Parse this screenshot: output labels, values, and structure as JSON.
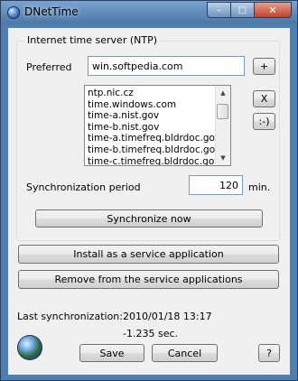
{
  "window": {
    "title": "DNetTime",
    "caption": {
      "minimize": "–",
      "maximize": "□",
      "close": "✕"
    }
  },
  "ntp": {
    "group_title": "Internet time server (NTP)",
    "preferred_label": "Preferred",
    "preferred_value": "win.softpedia.com",
    "add_button": "+",
    "remove_button": "X",
    "smiley_button": ":-)",
    "servers": [
      "ntp.nic.cz",
      "time.windows.com",
      "time-a.nist.gov",
      "time-b.nist.gov",
      "time-a.timefreq.bldrdoc.gov",
      "time-b.timefreq.bldrdoc.gov",
      "time-c.timefreq.bldrdoc.gov"
    ]
  },
  "sync": {
    "period_label": "Synchronization period",
    "period_value": "120",
    "period_unit": "min.",
    "sync_now_button": "Synchronize now"
  },
  "service": {
    "install_button": "Install as a service application",
    "remove_button": "Remove from the service applications"
  },
  "status": {
    "last_sync_label": "Last synchronization:",
    "last_sync_datetime": "2010/01/18 13:17",
    "offset": "-1.235 sec."
  },
  "footer": {
    "save_button": "Save",
    "cancel_button": "Cancel",
    "help_button": "?"
  },
  "icons": {
    "app": "globe-icon",
    "footer": "globe-icon"
  }
}
